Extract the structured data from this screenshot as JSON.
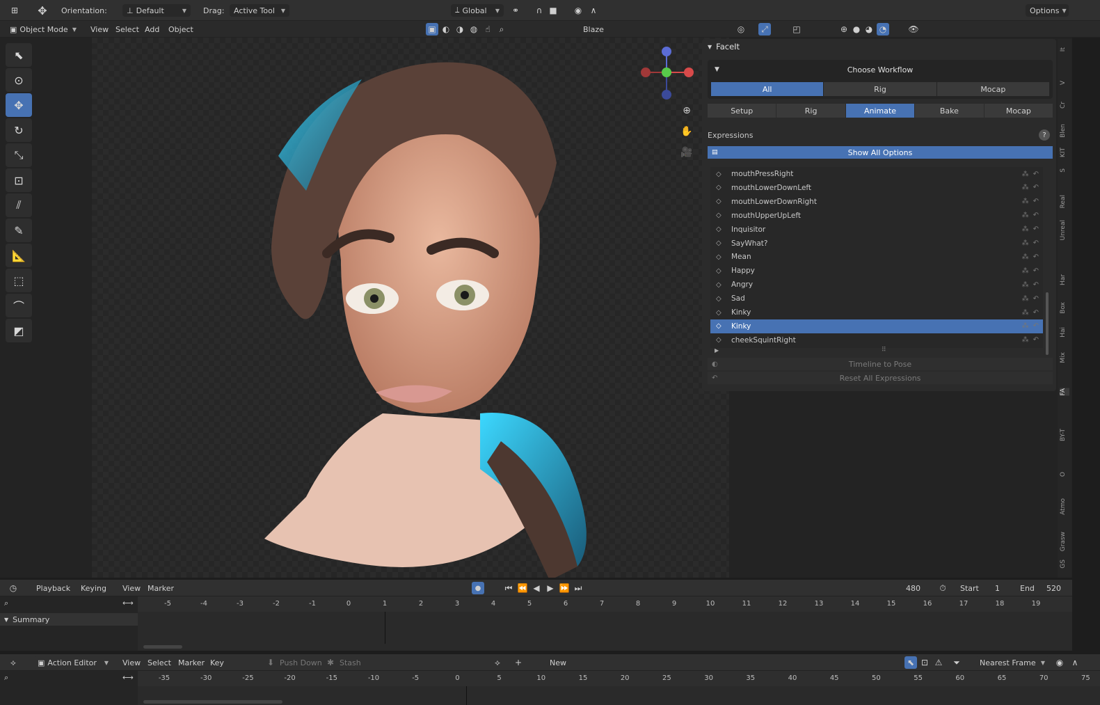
{
  "header": {
    "orientation_label": "Orientation:",
    "orientation_value": "Default",
    "drag_label": "Drag:",
    "drag_value": "Active Tool",
    "transform_space": "Global",
    "options_label": "Options"
  },
  "header2": {
    "mode": "Object Mode",
    "menus": [
      "View",
      "Select",
      "Add",
      "Object"
    ],
    "brush_name": "Blaze"
  },
  "panel": {
    "title": "FaceIt",
    "choose_workflow": "Choose Workflow",
    "workflow_tabs": [
      {
        "label": "All",
        "active": true
      },
      {
        "label": "Rig",
        "active": false
      },
      {
        "label": "Mocap",
        "active": false
      }
    ],
    "main_tabs": [
      {
        "label": "Setup",
        "active": false
      },
      {
        "label": "Rig",
        "active": false
      },
      {
        "label": "Animate",
        "active": true
      },
      {
        "label": "Bake",
        "active": false
      },
      {
        "label": "Mocap",
        "active": false
      }
    ],
    "expressions_label": "Expressions",
    "show_all_options": "Show All Options",
    "expressions": [
      {
        "name": "mouthPressRight",
        "selected": false
      },
      {
        "name": "mouthLowerDownLeft",
        "selected": false
      },
      {
        "name": "mouthLowerDownRight",
        "selected": false
      },
      {
        "name": "mouthUpperUpLeft",
        "selected": false
      },
      {
        "name": "Inquisitor",
        "selected": false
      },
      {
        "name": "SayWhat?",
        "selected": false
      },
      {
        "name": "Mean",
        "selected": false
      },
      {
        "name": "Happy",
        "selected": false
      },
      {
        "name": "Angry",
        "selected": false
      },
      {
        "name": "Sad",
        "selected": false
      },
      {
        "name": "Kinky",
        "selected": false
      },
      {
        "name": "Kinky",
        "selected": true
      },
      {
        "name": "cheekSquintRight",
        "selected": false
      }
    ],
    "timeline_to_pose": "Timeline to Pose",
    "reset_all": "Reset All Expressions"
  },
  "side_tabs": [
    "It",
    "V",
    "Cr",
    "Blen",
    "KIT",
    "S",
    "Real",
    "Unreal",
    "Har",
    "Box",
    "Hai",
    "Mix",
    "FA",
    "BY-T",
    "O",
    "Atmo",
    "Grasw",
    "GS"
  ],
  "timeline": {
    "menus": [
      "Playback",
      "Keying",
      "View",
      "Marker"
    ],
    "current_frame": "480",
    "start_label": "Start",
    "start": "1",
    "end_label": "End",
    "end": "520",
    "ticks": [
      "-5",
      "-4",
      "-3",
      "-2",
      "-1",
      "0",
      "1",
      "2",
      "3",
      "4",
      "5",
      "6",
      "7",
      "8",
      "9",
      "10",
      "11",
      "12",
      "13",
      "14",
      "15",
      "16",
      "17",
      "18",
      "19"
    ],
    "summary": "Summary"
  },
  "action_editor": {
    "mode": "Action Editor",
    "menus": [
      "View",
      "Select",
      "Marker",
      "Key"
    ],
    "push_down": "Push Down",
    "stash": "Stash",
    "new_label": "New",
    "snap": "Nearest Frame",
    "ticks": [
      "-35",
      "-30",
      "-25",
      "-20",
      "-15",
      "-10",
      "-5",
      "0",
      "5",
      "10",
      "15",
      "20",
      "25",
      "30",
      "35",
      "40",
      "45",
      "50",
      "55",
      "60",
      "65",
      "70",
      "75"
    ]
  },
  "colors": {
    "accent": "#4772b3",
    "panel_bg": "#2b2b2b"
  }
}
